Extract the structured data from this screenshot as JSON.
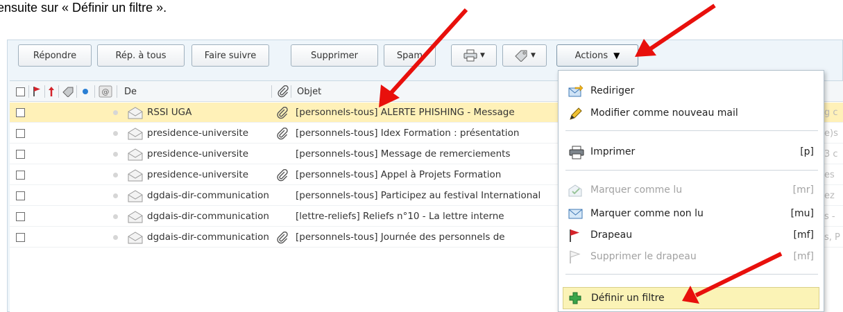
{
  "caption": "ensuite sur « Définir un filtre ».",
  "toolbar": {
    "reply": "Répondre",
    "reply_all": "Rép. à tous",
    "forward": "Faire suivre",
    "delete": "Supprimer",
    "spam": "Spam",
    "print_icon": "printer-icon",
    "tag_icon": "tag-icon",
    "actions": "Actions"
  },
  "columns": {
    "from": "De",
    "subject": "Objet"
  },
  "messages": [
    {
      "from": "RSSI UGA",
      "subject": "[personnels-tous] ALERTE PHISHING - Message",
      "attachment": true,
      "bleed": "g c",
      "selected": true
    },
    {
      "from": "presidence-universite",
      "subject": "[personnels-tous] Idex Formation : présentation",
      "attachment": true,
      "bleed": "e)s",
      "selected": false
    },
    {
      "from": "presidence-universite",
      "subject": "[personnels-tous] Message de remerciements",
      "attachment": false,
      "bleed": "3 c",
      "selected": false
    },
    {
      "from": "presidence-universite",
      "subject": "[personnels-tous] Appel à Projets Formation",
      "attachment": true,
      "bleed": "es",
      "selected": false
    },
    {
      "from": "dgdais-dir-communication",
      "subject": "[personnels-tous] Participez au festival International",
      "attachment": false,
      "bleed": "ez",
      "selected": false
    },
    {
      "from": "dgdais-dir-communication",
      "subject": "[lettre-reliefs] Reliefs n°10 - La lettre interne",
      "attachment": false,
      "bleed": "s -",
      "selected": false
    },
    {
      "from": "dgdais-dir-communication",
      "subject": "[personnels-tous] Journée des personnels de",
      "attachment": true,
      "bleed": "s, P",
      "selected": false
    }
  ],
  "menu": {
    "redirect": "Rediriger",
    "edit_as_new": "Modifier comme nouveau mail",
    "print": "Imprimer",
    "print_sc": "[p]",
    "mark_read": "Marquer comme lu",
    "mark_read_sc": "[mr]",
    "mark_unread": "Marquer comme non lu",
    "mark_unread_sc": "[mu]",
    "flag": "Drapeau",
    "flag_sc": "[mf]",
    "unflag": "Supprimer le drapeau",
    "unflag_sc": "[mf]",
    "define_filter": "Définir un filtre"
  },
  "colors": {
    "selected_row": "#fff1b8",
    "highlight_item": "#fbf3b6",
    "arrow": "#e8100c",
    "flag": "#d4232a"
  }
}
